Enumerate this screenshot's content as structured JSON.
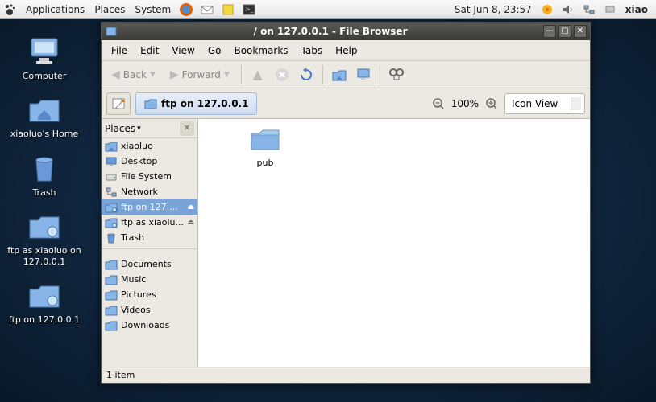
{
  "panel": {
    "menus": [
      "Applications",
      "Places",
      "System"
    ],
    "clock": "Sat Jun  8, 23:57",
    "user": "xiao"
  },
  "desktop_icons": [
    {
      "name": "computer",
      "label": "Computer",
      "icon": "monitor"
    },
    {
      "name": "home",
      "label": "xiaoluo's Home",
      "icon": "home-folder"
    },
    {
      "name": "trash",
      "label": "Trash",
      "icon": "trash"
    },
    {
      "name": "ftp-as",
      "label": "ftp as xiaoluo on 127.0.0.1",
      "icon": "folder-remote"
    },
    {
      "name": "ftp-on",
      "label": "ftp on 127.0.0.1",
      "icon": "folder-remote"
    }
  ],
  "window": {
    "title": "/ on 127.0.0.1 - File Browser",
    "menubar": [
      "File",
      "Edit",
      "View",
      "Go",
      "Bookmarks",
      "Tabs",
      "Help"
    ],
    "nav": {
      "back": "Back",
      "forward": "Forward"
    },
    "location_label": "ftp on 127.0.0.1",
    "zoom": "100%",
    "view_mode": "Icon View",
    "sidebar": {
      "header": "Places",
      "items": [
        {
          "label": "xiaoluo",
          "icon": "home-folder",
          "eject": false
        },
        {
          "label": "Desktop",
          "icon": "desktop",
          "eject": false
        },
        {
          "label": "File System",
          "icon": "drive",
          "eject": false
        },
        {
          "label": "Network",
          "icon": "network",
          "eject": false
        },
        {
          "label": "ftp on 127....",
          "icon": "folder-remote",
          "eject": true,
          "selected": true
        },
        {
          "label": "ftp as xiaolu...",
          "icon": "folder-remote",
          "eject": true
        },
        {
          "label": "Trash",
          "icon": "trash",
          "eject": false
        }
      ],
      "bookmarks": [
        {
          "label": "Documents",
          "icon": "folder"
        },
        {
          "label": "Music",
          "icon": "folder"
        },
        {
          "label": "Pictures",
          "icon": "folder"
        },
        {
          "label": "Videos",
          "icon": "folder"
        },
        {
          "label": "Downloads",
          "icon": "folder"
        }
      ]
    },
    "files": [
      {
        "name": "pub",
        "type": "folder"
      }
    ],
    "status": "1 item"
  }
}
